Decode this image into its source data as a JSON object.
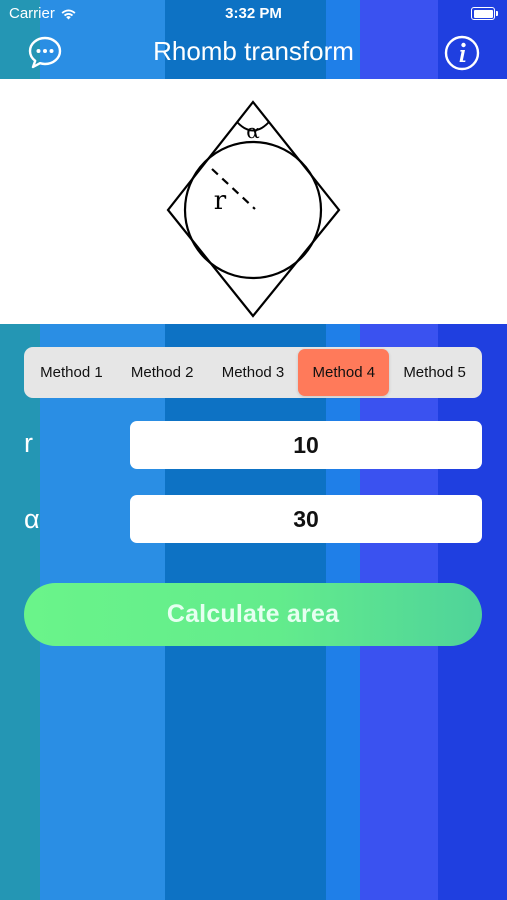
{
  "status_bar": {
    "carrier": "Carrier",
    "time": "3:32 PM"
  },
  "nav": {
    "title": "Rhomb transform",
    "left_icon": "chat-bubble-icon",
    "right_icon": "info-icon"
  },
  "illustration": {
    "angle_label": "α",
    "radius_label": "r"
  },
  "methods": {
    "items": [
      "Method 1",
      "Method 2",
      "Method 3",
      "Method 4",
      "Method 5"
    ],
    "selected_index": 3,
    "selected_color": "#ff7a5a"
  },
  "fields": {
    "r": {
      "label": "r",
      "value": "10"
    },
    "alpha": {
      "label": "α",
      "value": "30"
    }
  },
  "actions": {
    "calculate_label": "Calculate area",
    "calculate_color": "#6af48a"
  }
}
